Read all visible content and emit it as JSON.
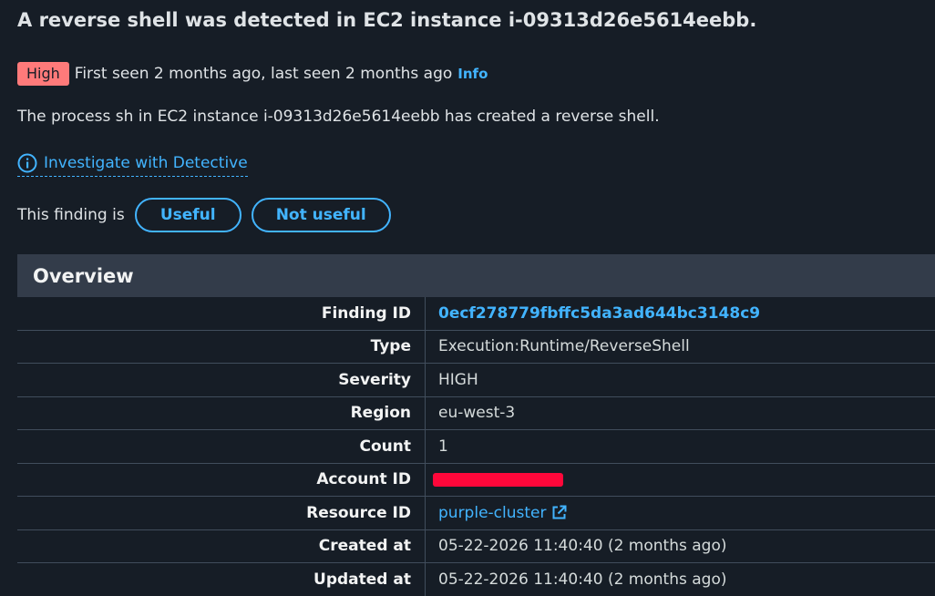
{
  "finding": {
    "title": "A reverse shell was detected in EC2 instance i-09313d26e5614eebb.",
    "severity_badge": "High",
    "seen_text": "First seen 2 months ago, last seen 2 months ago",
    "info_link": "Info",
    "description": "The process sh in EC2 instance i-09313d26e5614eebb has created a reverse shell.",
    "investigate_link": "Investigate with Detective"
  },
  "feedback": {
    "label": "This finding is",
    "useful": "Useful",
    "not_useful": "Not useful"
  },
  "overview": {
    "title": "Overview",
    "rows": [
      {
        "label": "Finding ID",
        "value": "0ecf278779fbffc5da3ad644bc3148c9"
      },
      {
        "label": "Type",
        "value": "Execution:Runtime/ReverseShell"
      },
      {
        "label": "Severity",
        "value": "HIGH"
      },
      {
        "label": "Region",
        "value": "eu-west-3"
      },
      {
        "label": "Count",
        "value": "1"
      },
      {
        "label": "Account ID",
        "value": ""
      },
      {
        "label": "Resource ID",
        "value": "purple-cluster"
      },
      {
        "label": "Created at",
        "value": "05-22-2026 11:40:40 (2 months ago)"
      },
      {
        "label": "Updated at",
        "value": "05-22-2026 11:40:40 (2 months ago)"
      }
    ]
  },
  "colors": {
    "background": "#161d26",
    "accent_link": "#42b4ff",
    "severity_high": "#ff7a7a",
    "redaction": "#ff073a",
    "header_bg": "#333c4a"
  },
  "icons": {
    "investigate": "info-circle-icon",
    "resource_link": "external-link-icon"
  }
}
